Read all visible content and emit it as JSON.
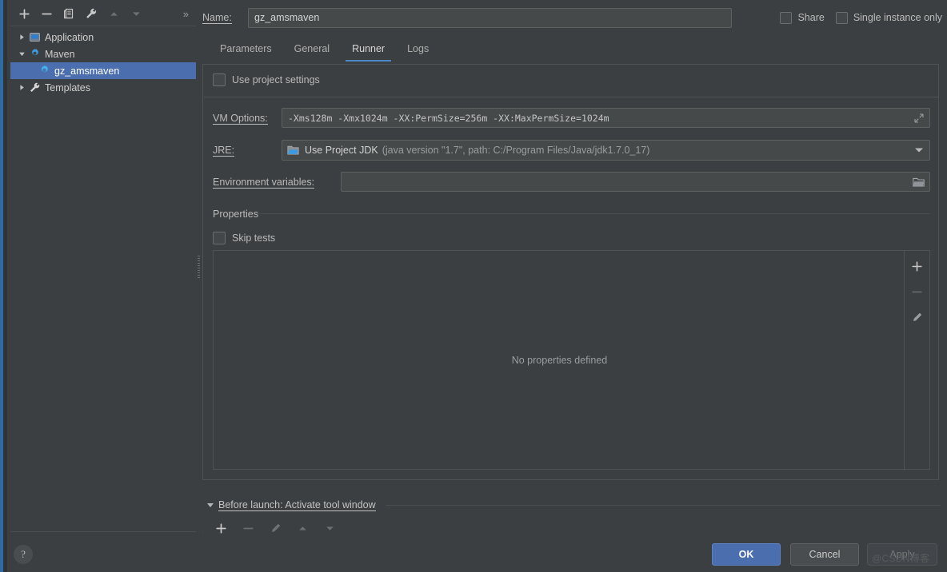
{
  "sidebar": {
    "toolbar": [
      {
        "name": "add-configuration-button",
        "icon": "plus-icon",
        "enabled": true
      },
      {
        "name": "remove-configuration-button",
        "icon": "minus-icon",
        "enabled": true
      },
      {
        "name": "copy-configuration-button",
        "icon": "copy-icon",
        "enabled": true
      },
      {
        "name": "edit-templates-button",
        "icon": "wrench-icon",
        "enabled": true
      },
      {
        "name": "move-up-button",
        "icon": "arrow-up-icon",
        "enabled": false
      },
      {
        "name": "move-down-button",
        "icon": "arrow-down-icon",
        "enabled": false
      }
    ],
    "expand_label": "»",
    "tree": [
      {
        "label": "Application",
        "icon": "application-icon",
        "expanded": false,
        "selected": false,
        "indent": false
      },
      {
        "label": "Maven",
        "icon": "maven-gear-icon",
        "expanded": true,
        "selected": false,
        "indent": false
      },
      {
        "label": "gz_amsmaven",
        "icon": "maven-gear-icon",
        "expanded": null,
        "selected": true,
        "indent": true
      },
      {
        "label": "Templates",
        "icon": "wrench-icon",
        "expanded": false,
        "selected": false,
        "indent": false
      }
    ]
  },
  "help": {
    "label": "?"
  },
  "header": {
    "name_label": "Name:",
    "name_value": "gz_amsmaven",
    "share_label": "Share",
    "share_checked": false,
    "single_instance_label": "Single instance only",
    "single_instance_checked": false
  },
  "tabs": [
    {
      "label": "Parameters",
      "active": false
    },
    {
      "label": "General",
      "active": false
    },
    {
      "label": "Runner",
      "active": true
    },
    {
      "label": "Logs",
      "active": false
    }
  ],
  "runner": {
    "use_project_settings_label": "Use project settings",
    "use_project_settings_checked": false,
    "vm_options_label": "VM Options:",
    "vm_options_value": "-Xms128m -Xmx1024m -XX:PermSize=256m -XX:MaxPermSize=1024m",
    "vm_options_expand_icon": "expand-icon",
    "jre_label": "JRE:",
    "jre_icon": "jdk-folder-icon",
    "jre_value": "Use Project JDK",
    "jre_detail": "(java version \"1.7\", path: C:/Program Files/Java/jdk1.7.0_17)",
    "env_label": "Environment variables:",
    "env_value": "",
    "env_browse_icon": "folder-icon",
    "properties_title": "Properties",
    "skip_tests_label": "Skip tests",
    "skip_tests_checked": false,
    "properties_empty_text": "No properties defined",
    "properties_toolbar": [
      {
        "name": "add-property-button",
        "icon": "plus-icon",
        "enabled": true
      },
      {
        "name": "remove-property-button",
        "icon": "minus-icon",
        "enabled": false
      },
      {
        "name": "edit-property-button",
        "icon": "pencil-icon",
        "enabled": true
      }
    ]
  },
  "before_launch": {
    "title": "Before launch: Activate tool window",
    "toolbar": [
      {
        "name": "add-task-button",
        "icon": "plus-icon",
        "enabled": true
      },
      {
        "name": "remove-task-button",
        "icon": "minus-icon",
        "enabled": false
      },
      {
        "name": "edit-task-button",
        "icon": "pencil-icon",
        "enabled": false
      },
      {
        "name": "move-task-up-button",
        "icon": "arrow-up-icon",
        "enabled": false
      },
      {
        "name": "move-task-down-button",
        "icon": "arrow-down-icon",
        "enabled": false
      }
    ]
  },
  "footer": {
    "ok_label": "OK",
    "cancel_label": "Cancel",
    "apply_label": "Apply",
    "apply_enabled": false
  },
  "watermark": {
    "text": "@CSDN博客"
  },
  "colors": {
    "background": "#3c3f41",
    "field_background": "#45494a",
    "accent_blue": "#4b6eaf",
    "tab_underline": "#4a88c7",
    "selection": "#4b6eaf",
    "border": "#4e5254",
    "text": "#bbbbbb",
    "muted_text": "#9a9d9f"
  }
}
